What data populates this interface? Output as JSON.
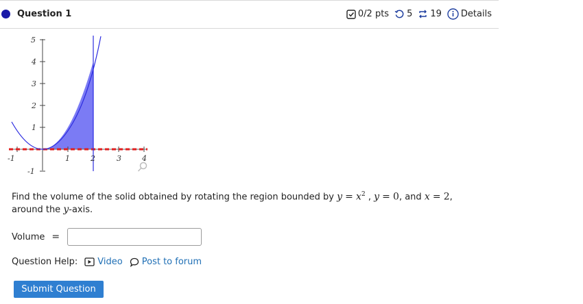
{
  "question": {
    "title": "Question 1",
    "points": "0/2 pts",
    "retries": "5",
    "attempts": "19",
    "details_label": "Details"
  },
  "graph": {
    "x_ticks": [
      "-1",
      "1",
      "2",
      "3",
      "4"
    ],
    "y_ticks": [
      "-1",
      "1",
      "2",
      "3",
      "4",
      "5"
    ],
    "curve": "y = x^2",
    "vertical_line": "x = 2",
    "shaded_region": "between y = x^2, y = 0, x = 2"
  },
  "prompt": {
    "lead": "Find the volume of the solid obtained by rotating the region bounded by",
    "eq1_lhs": "y",
    "eq1_rhs": "x",
    "eq1_exp": "2",
    "eq2_lhs": "y",
    "eq2_rhs": "0",
    "and": "and",
    "eq3_lhs": "x",
    "eq3_rhs": "2",
    "around_pre": "around the",
    "axis_var": "y",
    "around_post": "-axis."
  },
  "answer": {
    "label": "Volume",
    "equals": "="
  },
  "help": {
    "label": "Question Help:",
    "video": "Video",
    "forum": "Post to forum"
  },
  "submit_label": "Submit Question",
  "colors": {
    "accent": "#1a1aa8",
    "link": "#1f6fb5",
    "button": "#2f7fd1",
    "shade": "#7b7bf4",
    "dashed_axis": "#e02020"
  }
}
